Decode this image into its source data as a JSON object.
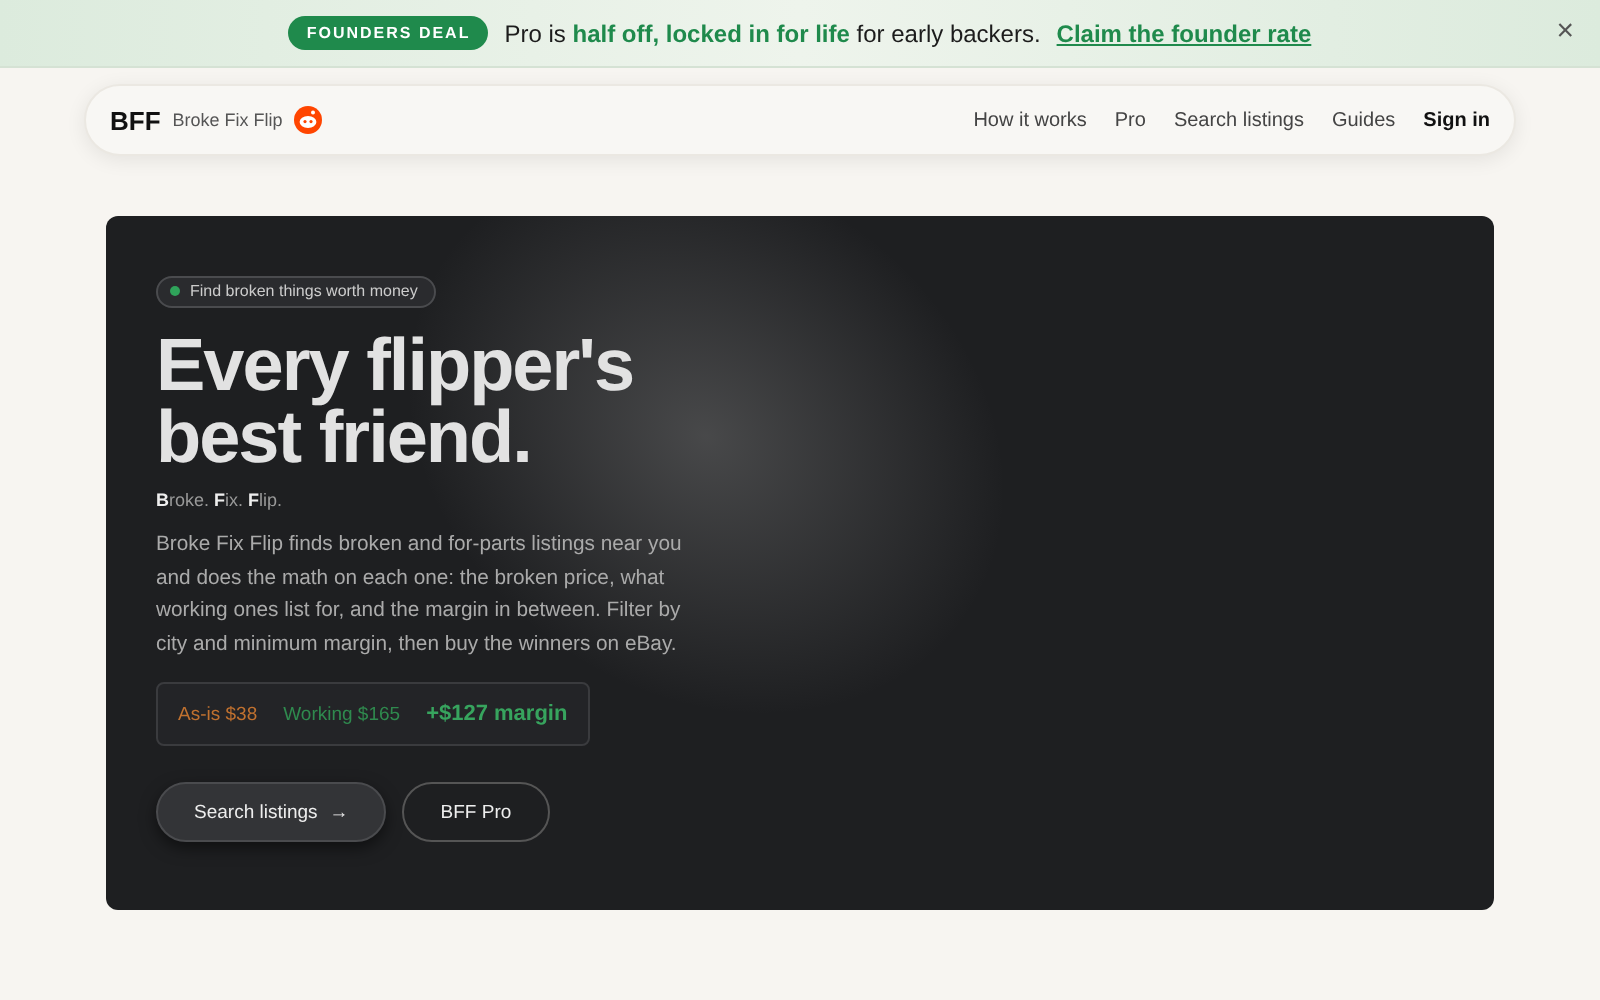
{
  "banner": {
    "badge": "FOUNDERS DEAL",
    "message": "Pro is **half off, locked in for life** for early backers.",
    "link": "Claim the founder rate",
    "close": "×"
  },
  "nav": {
    "logo": "BFF",
    "brand": "Broke Fix Flip",
    "links": [
      {
        "label": "How it works",
        "kind": "link"
      },
      {
        "label": "Pro",
        "kind": "link"
      },
      {
        "label": "Search listings",
        "kind": "link"
      },
      {
        "label": "Guides",
        "kind": "link"
      },
      {
        "label": "Sign in",
        "kind": "signin"
      }
    ]
  },
  "hero": {
    "pill": "Find broken things worth money",
    "title_lines": [
      "Every flipper's",
      "best friend."
    ],
    "tagline": "**B**roke. **F**ix. **F**lip.",
    "description": "Broke Fix Flip finds broken and for-parts listings near you and does the math on each one: the broken price, what working ones list for, and the margin in between. Filter by city and minimum margin, then buy the winners on eBay.",
    "prices": [
      {
        "label": "As-is $38",
        "kind": "asis"
      },
      {
        "label": "Working $165",
        "kind": "working"
      },
      {
        "label": "+$127 margin",
        "kind": "margin"
      }
    ],
    "buttons": [
      {
        "label": "Search listings",
        "kind": "primary",
        "arrow": "→"
      },
      {
        "label": "BFF Pro",
        "kind": "secondary"
      }
    ]
  }
}
